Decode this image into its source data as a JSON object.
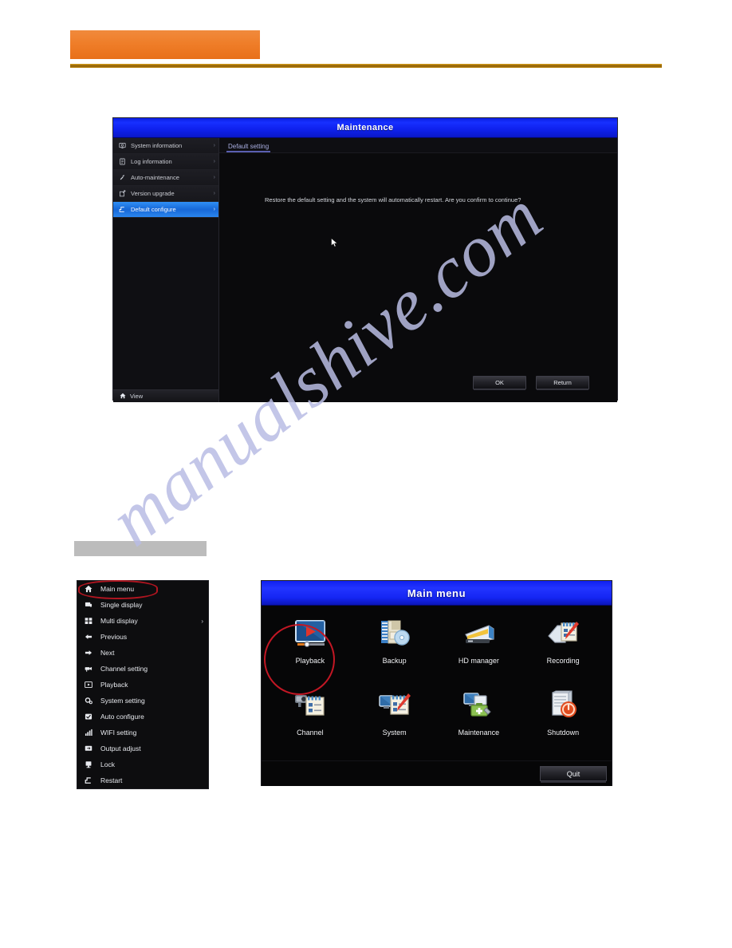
{
  "page": {
    "watermark": "manualshive.com"
  },
  "header": {
    "band_color": "#ef7d28",
    "rule_color": "#8a5b06"
  },
  "maintenance_dialog": {
    "title": "Maintenance",
    "sidebar": {
      "items": [
        {
          "label": "System information",
          "icon": "monitor-info-icon",
          "arrow": "›",
          "selected": false
        },
        {
          "label": "Log information",
          "icon": "log-document-icon",
          "arrow": "›",
          "selected": false
        },
        {
          "label": "Auto-maintenance",
          "icon": "wrench-icon",
          "arrow": "›",
          "selected": false
        },
        {
          "label": "Version upgrade",
          "icon": "upgrade-arrow-icon",
          "arrow": "›",
          "selected": false
        },
        {
          "label": "Default configure",
          "icon": "restore-icon",
          "arrow": "›",
          "selected": true
        }
      ]
    },
    "footer": {
      "label": "View",
      "icon": "home-icon"
    },
    "tab": "Default setting",
    "message": "Restore the default setting and the system will automatically restart. Are you confirm to continue?",
    "buttons": {
      "ok": "OK",
      "return": "Return"
    },
    "highlight_color": "#2f8ff5",
    "titlebar_color": "#1730ff"
  },
  "context_menu": {
    "highlighted_item": "Main menu",
    "highlight_color": "#b01520",
    "items": [
      {
        "label": "Main menu",
        "icon": "home-icon",
        "arrow": ""
      },
      {
        "label": "Single display",
        "icon": "single-screen-icon",
        "arrow": ""
      },
      {
        "label": "Multi display",
        "icon": "grid-screen-icon",
        "arrow": "›"
      },
      {
        "label": "Previous",
        "icon": "arrow-left-icon",
        "arrow": ""
      },
      {
        "label": "Next",
        "icon": "arrow-right-icon",
        "arrow": ""
      },
      {
        "label": "Channel setting",
        "icon": "camera-icon",
        "arrow": ""
      },
      {
        "label": "Playback",
        "icon": "playback-icon",
        "arrow": ""
      },
      {
        "label": "System setting",
        "icon": "gear-icon",
        "arrow": ""
      },
      {
        "label": "Auto configure",
        "icon": "checkbox-icon",
        "arrow": ""
      },
      {
        "label": "WIFI setting",
        "icon": "signal-bars-icon",
        "arrow": ""
      },
      {
        "label": "Output adjust",
        "icon": "output-screen-icon",
        "arrow": ""
      },
      {
        "label": "Lock",
        "icon": "lock-icon",
        "arrow": ""
      },
      {
        "label": "Restart",
        "icon": "restart-icon",
        "arrow": ""
      }
    ]
  },
  "main_menu_dialog": {
    "title": "Main menu",
    "highlighted_item": "Shutdown",
    "highlight_color": "#c21724",
    "titlebar_color": "#2234ff",
    "items": [
      {
        "label": "Playback",
        "icon": "playback-video-icon"
      },
      {
        "label": "Backup",
        "icon": "backup-disc-icon"
      },
      {
        "label": "HD manager",
        "icon": "harddisk-icon"
      },
      {
        "label": "Recording",
        "icon": "recording-icon"
      },
      {
        "label": "Channel",
        "icon": "channel-camera-icon"
      },
      {
        "label": "System",
        "icon": "system-icon"
      },
      {
        "label": "Maintenance",
        "icon": "maintenance-toolbox-icon"
      },
      {
        "label": "Shutdown",
        "icon": "shutdown-power-icon"
      }
    ],
    "quit_button": "Quit"
  }
}
